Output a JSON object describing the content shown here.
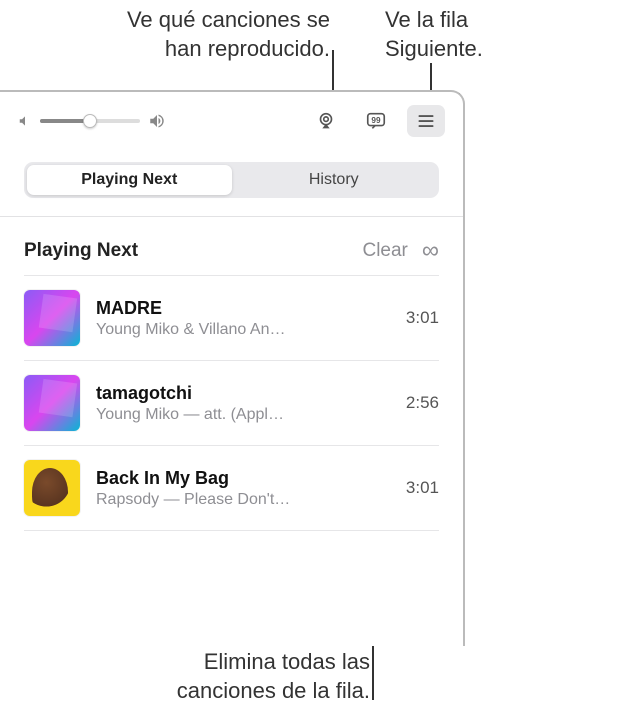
{
  "callouts": {
    "history": "Ve qué canciones se\nhan reproducido.",
    "queueButton": "Ve la fila\nSiguiente.",
    "clear": "Elimina todas las\ncanciones de la fila."
  },
  "toolbar": {
    "airplayIcon": "airplay-icon",
    "lyricsIcon": "lyrics-icon",
    "queueIcon": "queue-list-icon"
  },
  "segmented": {
    "playingNext": "Playing Next",
    "history": "History"
  },
  "section": {
    "title": "Playing Next",
    "clear": "Clear"
  },
  "tracks": [
    {
      "title": "MADRE",
      "subtitle": "Young Miko & Villano An…",
      "duration": "3:01"
    },
    {
      "title": "tamagotchi",
      "subtitle": "Young Miko — att. (Appl…",
      "duration": "2:56"
    },
    {
      "title": "Back In My Bag",
      "subtitle": "Rapsody — Please Don't…",
      "duration": "3:01"
    }
  ]
}
